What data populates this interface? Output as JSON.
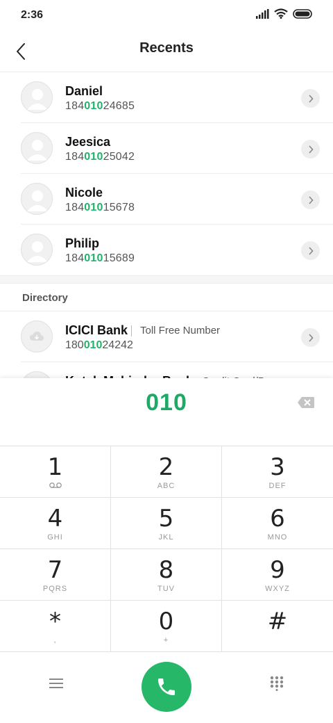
{
  "status_bar": {
    "time": "2:36",
    "icons": [
      "signal-icon",
      "wifi-icon",
      "battery-icon"
    ]
  },
  "header": {
    "title": "Recents",
    "back_icon": "back-icon"
  },
  "recents": [
    {
      "name": "Daniel",
      "number_prefix": "184",
      "number_match": "010",
      "number_suffix": "24685"
    },
    {
      "name": "Jeesica",
      "number_prefix": "184",
      "number_match": "010",
      "number_suffix": "25042"
    },
    {
      "name": "Nicole",
      "number_prefix": "184",
      "number_match": "010",
      "number_suffix": "15678"
    },
    {
      "name": "Philip",
      "number_prefix": "184",
      "number_match": "010",
      "number_suffix": "15689"
    }
  ],
  "directory": {
    "title": "Directory",
    "items": [
      {
        "name": "ICICI Bank",
        "type": "Toll Free Number",
        "number_prefix": "180",
        "number_match": "010",
        "number_suffix": "24242"
      },
      {
        "name": "Kotak Mahindra Bank",
        "type": "Credit Card/Ba"
      }
    ]
  },
  "dialer": {
    "value": "010",
    "keys": [
      {
        "digit": "1",
        "letters": ""
      },
      {
        "digit": "2",
        "letters": "ABC"
      },
      {
        "digit": "3",
        "letters": "DEF"
      },
      {
        "digit": "4",
        "letters": "GHI"
      },
      {
        "digit": "5",
        "letters": "JKL"
      },
      {
        "digit": "6",
        "letters": "MNO"
      },
      {
        "digit": "7",
        "letters": "PQRS"
      },
      {
        "digit": "8",
        "letters": "TUV"
      },
      {
        "digit": "9",
        "letters": "WXYZ"
      },
      {
        "digit": "*",
        "letters": ","
      },
      {
        "digit": "0",
        "letters": "+"
      },
      {
        "digit": "#",
        "letters": ""
      }
    ]
  },
  "colors": {
    "accent": "#1fb36b",
    "call_button": "#26b768"
  }
}
